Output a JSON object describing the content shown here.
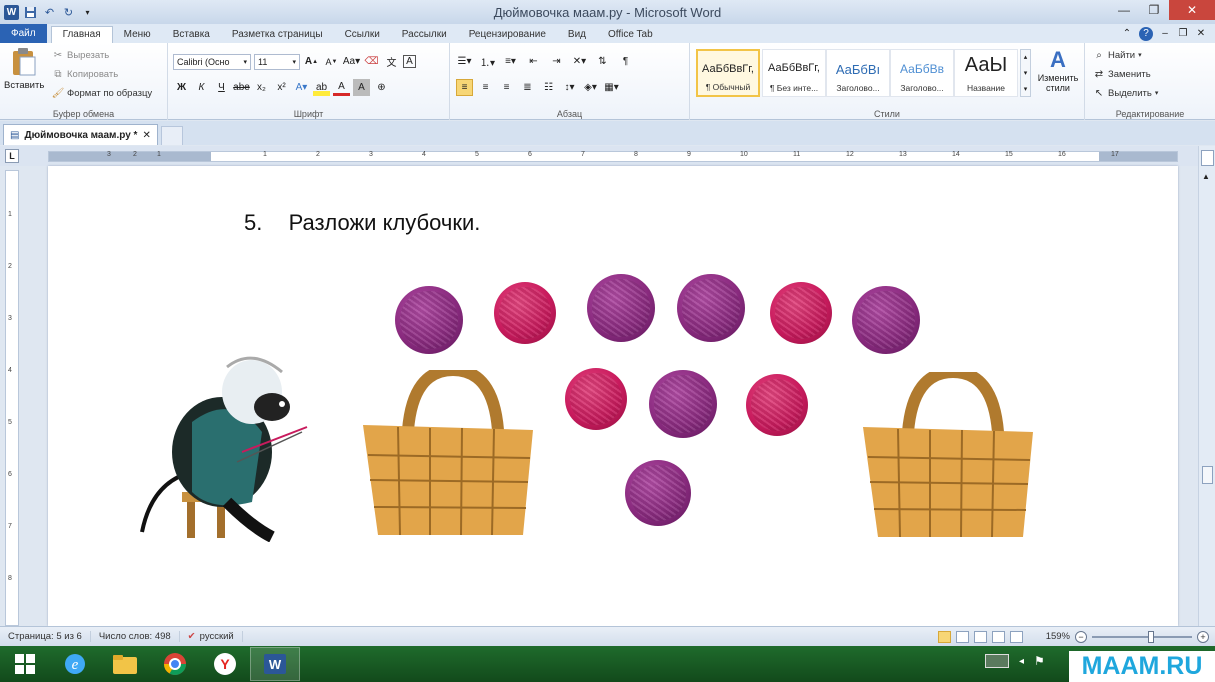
{
  "window": {
    "title": "Дюймовочка маам.ру - Microsoft Word"
  },
  "ribbon_tabs": [
    "Файл",
    "Главная",
    "Меню",
    "Вставка",
    "Разметка страницы",
    "Ссылки",
    "Рассылки",
    "Рецензирование",
    "Вид",
    "Office Tab"
  ],
  "clipboard": {
    "paste": "Вставить",
    "cut": "Вырезать",
    "copy": "Копировать",
    "format_painter": "Формат по образцу",
    "label": "Буфер обмена"
  },
  "font": {
    "name": "Calibri (Осно",
    "size": "11",
    "label": "Шрифт"
  },
  "paragraph": {
    "label": "Абзац"
  },
  "styles": {
    "items": [
      {
        "sample": "АаБбВвГг,",
        "name": "¶ Обычный"
      },
      {
        "sample": "АаБбВвГг,",
        "name": "¶ Без инте..."
      },
      {
        "sample": "АаБбВı",
        "name": "Заголово..."
      },
      {
        "sample": "АаБбВв",
        "name": "Заголово..."
      },
      {
        "sample": "АаЫ",
        "name": "Название"
      }
    ],
    "change": "Изменить стили",
    "label": "Стили"
  },
  "editing": {
    "find": "Найти",
    "replace": "Заменить",
    "select": "Выделить",
    "label": "Редактирование"
  },
  "document_tab": {
    "name": "Дюймовочка маам.ру *"
  },
  "ruler": {
    "numbers": [
      "1",
      "2",
      "3",
      "4",
      "5",
      "6",
      "7",
      "8",
      "9",
      "10",
      "11",
      "12",
      "13",
      "14",
      "15",
      "16",
      "17"
    ],
    "vnumbers": [
      "1",
      "2",
      "3",
      "4",
      "5",
      "6",
      "7",
      "8",
      "9"
    ],
    "left_numbers": [
      "3",
      "2",
      "1"
    ]
  },
  "document": {
    "task_number": "5.",
    "task_text": "Разложи клубочки.",
    "yarn_colors": {
      "purple": "#8a2b7f",
      "pink": "#c81b5d"
    }
  },
  "status": {
    "page": "Страница: 5 из 6",
    "words": "Число слов: 498",
    "language": "русский",
    "zoom": "159%"
  },
  "watermark": "MAAM.RU"
}
